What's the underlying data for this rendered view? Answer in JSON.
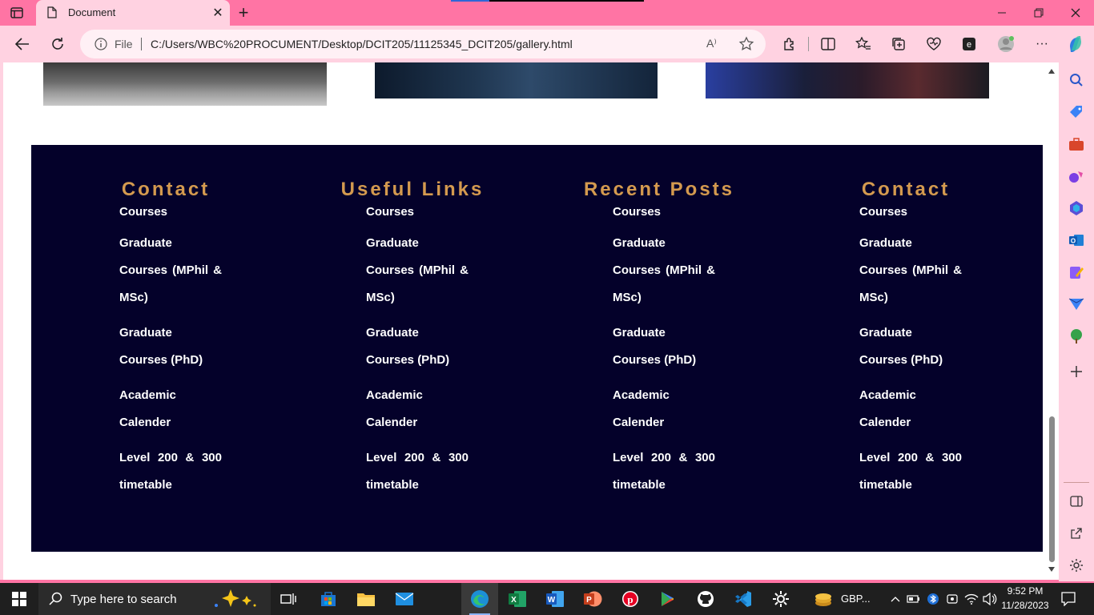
{
  "browser": {
    "tab": {
      "title": "Document",
      "close": "✕"
    },
    "new_tab": "+",
    "window_controls": {
      "minimize": "—",
      "maximize": "❐",
      "close": "✕"
    },
    "address": {
      "scheme_label": "File",
      "url": "C:/Users/WBC%20PROCUMENT/Desktop/DCIT205/11125345_DCIT205/gallery.html",
      "read_aloud": "A⁾"
    },
    "more": "···"
  },
  "page": {
    "footer": {
      "columns": [
        {
          "heading": "Contact",
          "links": [
            "Courses",
            "Graduate Courses (MPhil & MSc)",
            "Graduate Courses (PhD)",
            "Academic Calender",
            "Level 200 & 300 timetable"
          ]
        },
        {
          "heading": "Useful Links",
          "links": [
            "Courses",
            "Graduate Courses (MPhil & MSc)",
            "Graduate Courses (PhD)",
            "Academic Calender",
            "Level 200 & 300 timetable"
          ]
        },
        {
          "heading": "Recent Posts",
          "links": [
            "Courses",
            "Graduate Courses (MPhil & MSc)",
            "Graduate Courses (PhD)",
            "Academic Calender",
            "Level 200 & 300 timetable"
          ]
        },
        {
          "heading": "Contact",
          "links": [
            "Courses",
            "Graduate Courses (MPhil & MSc)",
            "Graduate Courses (PhD)",
            "Academic Calender",
            "Level 200 & 300 timetable"
          ]
        }
      ]
    }
  },
  "taskbar": {
    "search_placeholder": "Type here to search",
    "weather_text": "GBP...",
    "time": "9:52 PM",
    "date": "11/28/2023"
  },
  "colors": {
    "accent_pink": "#ff74a4",
    "toolbar_pink": "#ffd2e1",
    "footer_bg": "#04012a",
    "footer_heading": "#d49a4f"
  }
}
